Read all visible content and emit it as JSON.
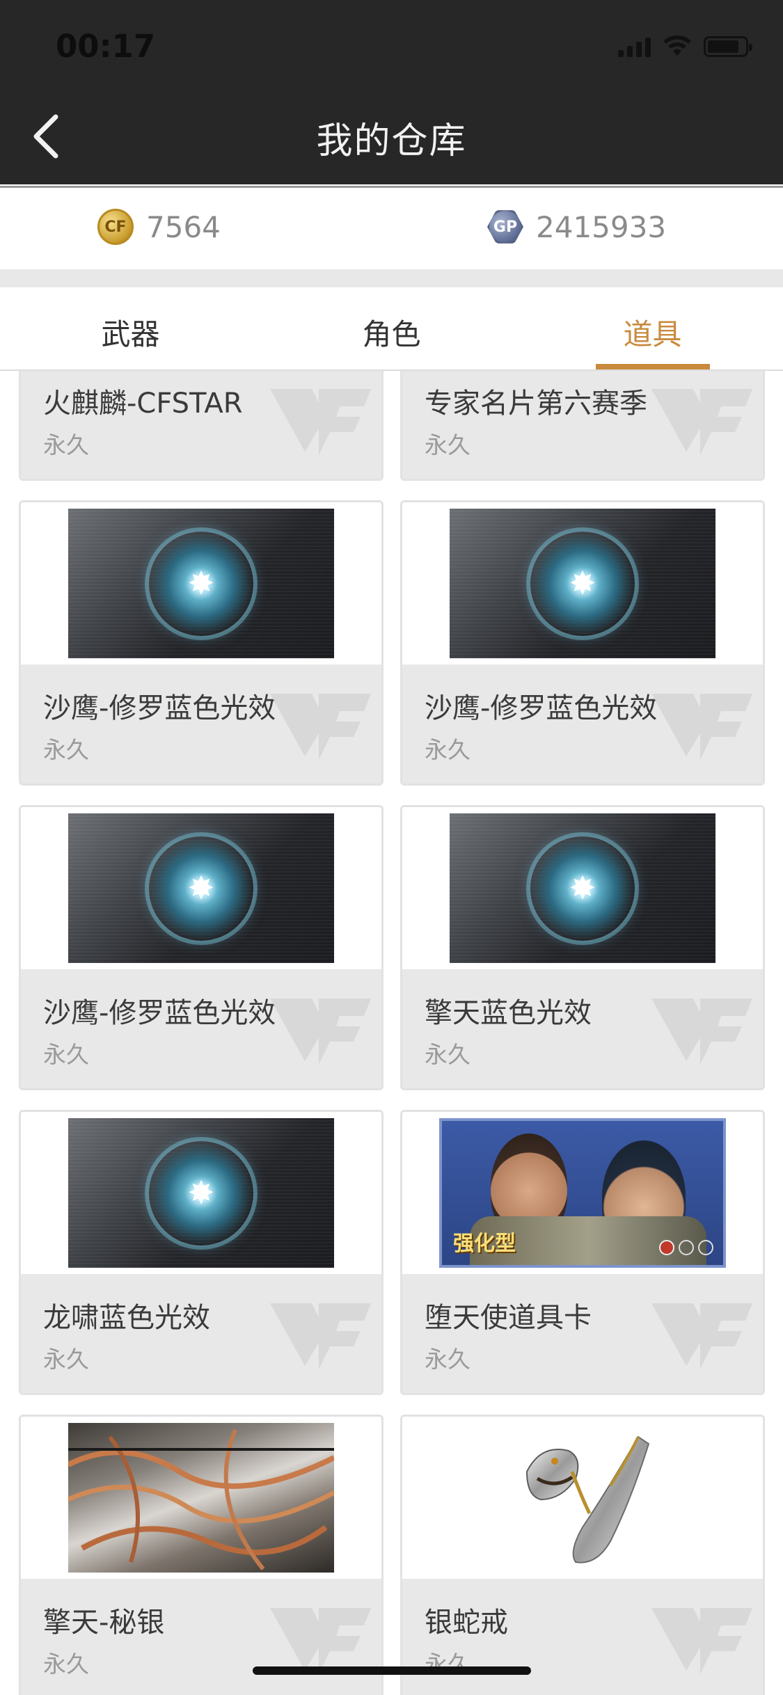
{
  "status_bar": {
    "time": "00:17"
  },
  "nav": {
    "title": "我的仓库"
  },
  "currency": [
    {
      "icon": "cf-coin-icon",
      "label": "CF",
      "value": "7564"
    },
    {
      "icon": "gp-coin-icon",
      "label": "GP",
      "value": "2415933"
    }
  ],
  "tabs": [
    {
      "label": "武器",
      "active": false
    },
    {
      "label": "角色",
      "active": false
    },
    {
      "label": "道具",
      "active": true
    }
  ],
  "colors": {
    "accent": "#c98a3d",
    "header_bg": "#272727",
    "card_info_bg": "#e8e8e8"
  },
  "items": [
    {
      "name": "火麒麟-CFSTAR",
      "duration": "永久",
      "thumb": "weapon-partial"
    },
    {
      "name": "专家名片第六赛季",
      "duration": "永久",
      "thumb": "card-partial"
    },
    {
      "name": "沙鹰-修罗蓝色光效",
      "duration": "永久",
      "thumb": "blue-effect"
    },
    {
      "name": "沙鹰-修罗蓝色光效",
      "duration": "永久",
      "thumb": "blue-effect"
    },
    {
      "name": "沙鹰-修罗蓝色光效",
      "duration": "永久",
      "thumb": "blue-effect"
    },
    {
      "name": "擎天蓝色光效",
      "duration": "永久",
      "thumb": "blue-effect"
    },
    {
      "name": "龙啸蓝色光效",
      "duration": "永久",
      "thumb": "blue-effect"
    },
    {
      "name": "堕天使道具卡",
      "duration": "永久",
      "thumb": "character-card",
      "badge": "强化型"
    },
    {
      "name": "擎天-秘银",
      "duration": "永久",
      "thumb": "silver-skin"
    },
    {
      "name": "银蛇戒",
      "duration": "永久",
      "thumb": "snake-ring"
    }
  ]
}
